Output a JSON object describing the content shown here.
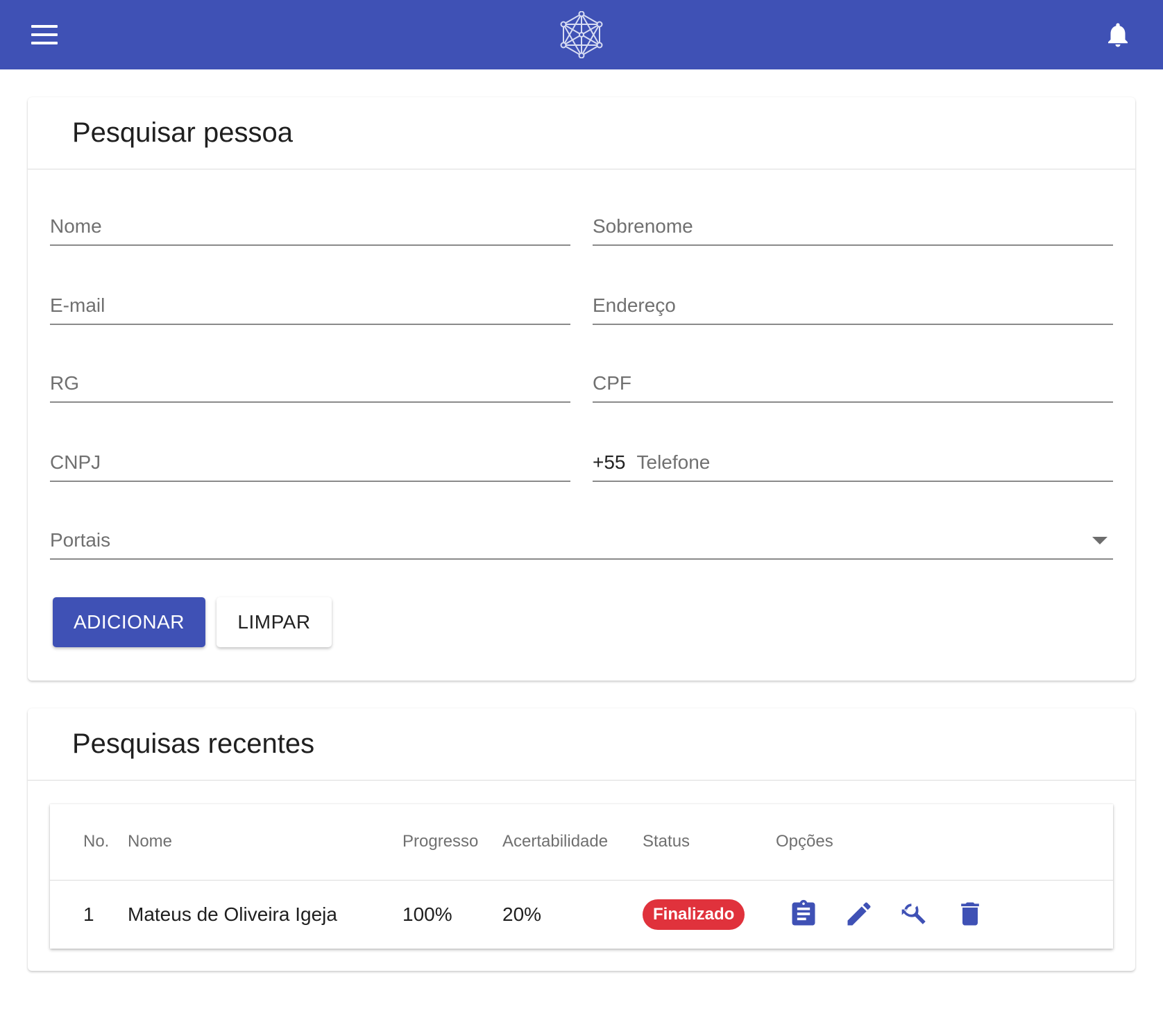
{
  "header": {
    "menu_icon": "menu-icon",
    "logo_icon": "network-logo-icon",
    "notification_icon": "bell-icon",
    "color": "#3f51b5"
  },
  "search": {
    "title": "Pesquisar pessoa",
    "fields": {
      "nome": {
        "placeholder": "Nome",
        "value": ""
      },
      "sobrenome": {
        "placeholder": "Sobrenome",
        "value": ""
      },
      "email": {
        "placeholder": "E-mail",
        "value": ""
      },
      "endereco": {
        "placeholder": "Endereço",
        "value": ""
      },
      "rg": {
        "placeholder": "RG",
        "value": ""
      },
      "cpf": {
        "placeholder": "CPF",
        "value": ""
      },
      "cnpj": {
        "placeholder": "CNPJ",
        "value": ""
      },
      "telefone": {
        "prefix": "+55",
        "placeholder": "Telefone",
        "value": ""
      },
      "portais": {
        "placeholder": "Portais",
        "value": ""
      }
    },
    "buttons": {
      "add_label": "ADICIONAR",
      "clear_label": "LIMPAR"
    }
  },
  "recent": {
    "title": "Pesquisas recentes",
    "columns": {
      "no": "No.",
      "nome": "Nome",
      "progresso": "Progresso",
      "acertabilidade": "Acertabilidade",
      "status": "Status",
      "opcoes": "Opções"
    },
    "rows": [
      {
        "no": "1",
        "nome": "Mateus de Oliveira Igeja",
        "progresso": "100%",
        "acertabilidade": "20%",
        "status": "Finalizado",
        "status_color": "#e0323c",
        "option_icons": [
          "clipboard-icon",
          "pencil-icon",
          "search-refresh-icon",
          "trash-icon"
        ]
      }
    ]
  }
}
